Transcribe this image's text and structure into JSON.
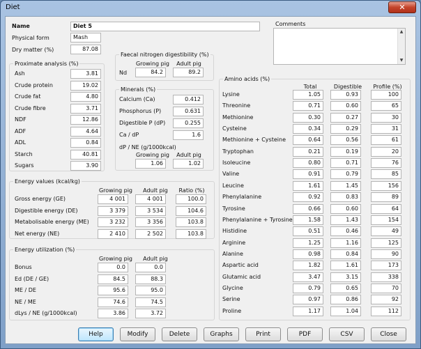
{
  "window": {
    "title": "Diet",
    "close_glyph": "✕"
  },
  "header": {
    "name_label": "Name",
    "name_value": "Diet 5",
    "physical_form_label": "Physical form",
    "physical_form_value": "Mash",
    "dry_matter_label": "Dry matter (%)",
    "dry_matter_value": "87.08",
    "comments_label": "Comments"
  },
  "proximate": {
    "title": "Proximate analysis (%)",
    "rows": [
      {
        "label": "Ash",
        "value": "3.81"
      },
      {
        "label": "Crude protein",
        "value": "19.02"
      },
      {
        "label": "Crude fat",
        "value": "4.80"
      },
      {
        "label": "Crude fibre",
        "value": "3.71"
      },
      {
        "label": "NDF",
        "value": "12.86"
      },
      {
        "label": "ADF",
        "value": "4.64"
      },
      {
        "label": "ADL",
        "value": "0.84"
      },
      {
        "label": "Starch",
        "value": "40.81"
      },
      {
        "label": "Sugars",
        "value": "3.90"
      }
    ]
  },
  "faecal": {
    "title": "Faecal nitrogen digestibility (%)",
    "col_growing": "Growing pig",
    "col_adult": "Adult pig",
    "row_label": "Nd",
    "growing": "84.2",
    "adult": "89.2"
  },
  "minerals": {
    "title": "Minerals (%)",
    "rows": [
      {
        "label": "Calcium (Ca)",
        "value": "0.412"
      },
      {
        "label": "Phosphorus (P)",
        "value": "0.631"
      },
      {
        "label": "Digestible P (dP)",
        "value": "0.255"
      },
      {
        "label": "Ca / dP",
        "value": "1.6"
      }
    ],
    "dp_ne_label": "dP / NE (g/1000kcal)",
    "col_growing": "Growing pig",
    "col_adult": "Adult pig",
    "dp_ne_growing": "1.06",
    "dp_ne_adult": "1.02"
  },
  "energy_values": {
    "title": "Energy values (kcal/kg)",
    "col_growing": "Growing pig",
    "col_adult": "Adult pig",
    "col_ratio": "Ratio (%)",
    "rows": [
      {
        "label": "Gross energy (GE)",
        "growing": "4 001",
        "adult": "4 001",
        "ratio": "100.0"
      },
      {
        "label": "Digestible energy (DE)",
        "growing": "3 379",
        "adult": "3 534",
        "ratio": "104.6"
      },
      {
        "label": "Metabolisable energy (ME)",
        "growing": "3 232",
        "adult": "3 356",
        "ratio": "103.8"
      },
      {
        "label": "Net energy (NE)",
        "growing": "2 410",
        "adult": "2 502",
        "ratio": "103.8"
      }
    ]
  },
  "energy_util": {
    "title": "Energy utilization (%)",
    "col_growing": "Growing pig",
    "col_adult": "Adult pig",
    "rows": [
      {
        "label": "Bonus",
        "growing": "0.0",
        "adult": "0.0"
      },
      {
        "label": "Ed (DE / GE)",
        "growing": "84.5",
        "adult": "88.3"
      },
      {
        "label": "ME / DE",
        "growing": "95.6",
        "adult": "95.0"
      },
      {
        "label": "NE / ME",
        "growing": "74.6",
        "adult": "74.5"
      },
      {
        "label": "dLys / NE (g/1000kcal)",
        "growing": "3.86",
        "adult": "3.72"
      }
    ]
  },
  "amino": {
    "title": "Amino acids (%)",
    "col_total": "Total",
    "col_digestible": "Digestible",
    "col_profile": "Profile (%)",
    "rows": [
      {
        "label": "Lysine",
        "total": "1.05",
        "digestible": "0.93",
        "profile": "100"
      },
      {
        "label": "Threonine",
        "total": "0.71",
        "digestible": "0.60",
        "profile": "65"
      },
      {
        "label": "Methionine",
        "total": "0.30",
        "digestible": "0.27",
        "profile": "30"
      },
      {
        "label": "Cysteine",
        "total": "0.34",
        "digestible": "0.29",
        "profile": "31"
      },
      {
        "label": "Methionine + Cysteine",
        "total": "0.64",
        "digestible": "0.56",
        "profile": "61"
      },
      {
        "label": "Tryptophan",
        "total": "0.21",
        "digestible": "0.19",
        "profile": "20"
      },
      {
        "label": "Isoleucine",
        "total": "0.80",
        "digestible": "0.71",
        "profile": "76"
      },
      {
        "label": "Valine",
        "total": "0.91",
        "digestible": "0.79",
        "profile": "85"
      },
      {
        "label": "Leucine",
        "total": "1.61",
        "digestible": "1.45",
        "profile": "156"
      },
      {
        "label": "Phenylalanine",
        "total": "0.92",
        "digestible": "0.83",
        "profile": "89"
      },
      {
        "label": "Tyrosine",
        "total": "0.66",
        "digestible": "0.60",
        "profile": "64"
      },
      {
        "label": "Phenylalanine + Tyrosine",
        "total": "1.58",
        "digestible": "1.43",
        "profile": "154"
      },
      {
        "label": "Histidine",
        "total": "0.51",
        "digestible": "0.46",
        "profile": "49"
      },
      {
        "label": "Arginine",
        "total": "1.25",
        "digestible": "1.16",
        "profile": "125"
      },
      {
        "label": "Alanine",
        "total": "0.98",
        "digestible": "0.84",
        "profile": "90"
      },
      {
        "label": "Aspartic acid",
        "total": "1.82",
        "digestible": "1.61",
        "profile": "173"
      },
      {
        "label": "Glutamic acid",
        "total": "3.47",
        "digestible": "3.15",
        "profile": "338"
      },
      {
        "label": "Glycine",
        "total": "0.79",
        "digestible": "0.65",
        "profile": "70"
      },
      {
        "label": "Serine",
        "total": "0.97",
        "digestible": "0.86",
        "profile": "92"
      },
      {
        "label": "Proline",
        "total": "1.17",
        "digestible": "1.04",
        "profile": "112"
      }
    ]
  },
  "buttons": [
    {
      "label": "Help",
      "name": "help-button"
    },
    {
      "label": "Modify",
      "name": "modify-button"
    },
    {
      "label": "Delete",
      "name": "delete-button"
    },
    {
      "label": "Graphs",
      "name": "graphs-button"
    },
    {
      "label": "Print",
      "name": "print-button"
    },
    {
      "label": "PDF",
      "name": "pdf-button"
    },
    {
      "label": "CSV",
      "name": "csv-button"
    },
    {
      "label": "Close",
      "name": "close-button"
    }
  ]
}
